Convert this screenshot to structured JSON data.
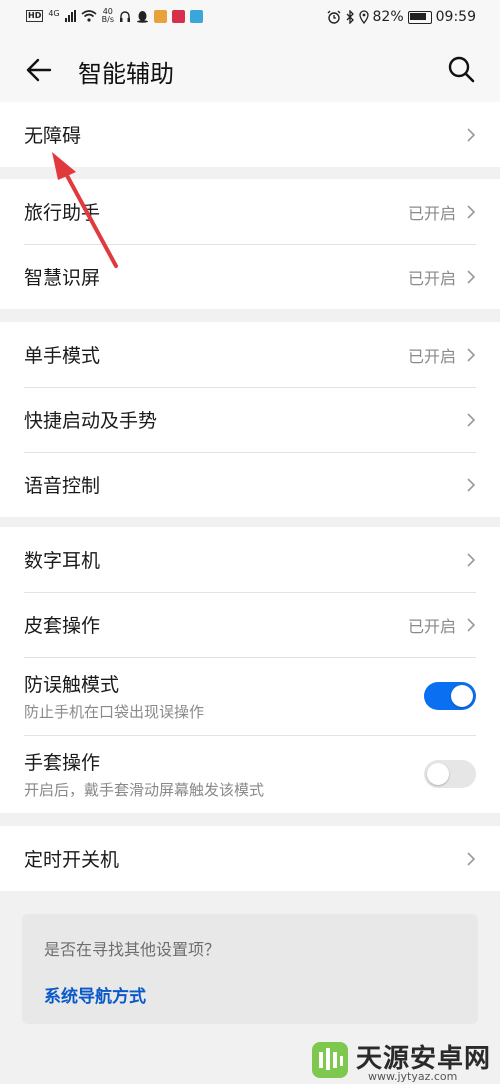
{
  "status_bar": {
    "net_speed_value": "40",
    "net_speed_unit": "B/s",
    "network_label": "HD",
    "signal_gen": "4G",
    "battery_percent": "82%",
    "time": "09:59"
  },
  "header": {
    "title": "智能辅助"
  },
  "group1": {
    "items": [
      {
        "label": "无障碍",
        "status": ""
      }
    ]
  },
  "group2": {
    "items": [
      {
        "label": "旅行助手",
        "status": "已开启"
      },
      {
        "label": "智慧识屏",
        "status": "已开启"
      }
    ]
  },
  "group3": {
    "items": [
      {
        "label": "单手模式",
        "status": "已开启"
      },
      {
        "label": "快捷启动及手势",
        "status": ""
      },
      {
        "label": "语音控制",
        "status": ""
      }
    ]
  },
  "group4": {
    "items": [
      {
        "label": "数字耳机",
        "status": ""
      },
      {
        "label": "皮套操作",
        "status": "已开启"
      },
      {
        "label": "防误触模式",
        "subtitle": "防止手机在口袋出现误操作",
        "enabled": true
      },
      {
        "label": "手套操作",
        "subtitle": "开启后，戴手套滑动屏幕触发该模式",
        "enabled": false
      }
    ]
  },
  "group5": {
    "items": [
      {
        "label": "定时开关机",
        "status": ""
      }
    ]
  },
  "hint": {
    "question": "是否在寻找其他设置项？",
    "link": "系统导航方式"
  },
  "watermark": {
    "name": "天源安卓网",
    "url": "www.jytyaz.com"
  },
  "colors": {
    "accent": "#0a6ff0",
    "link": "#0a59c9",
    "annotation_arrow": "#e0393e"
  }
}
